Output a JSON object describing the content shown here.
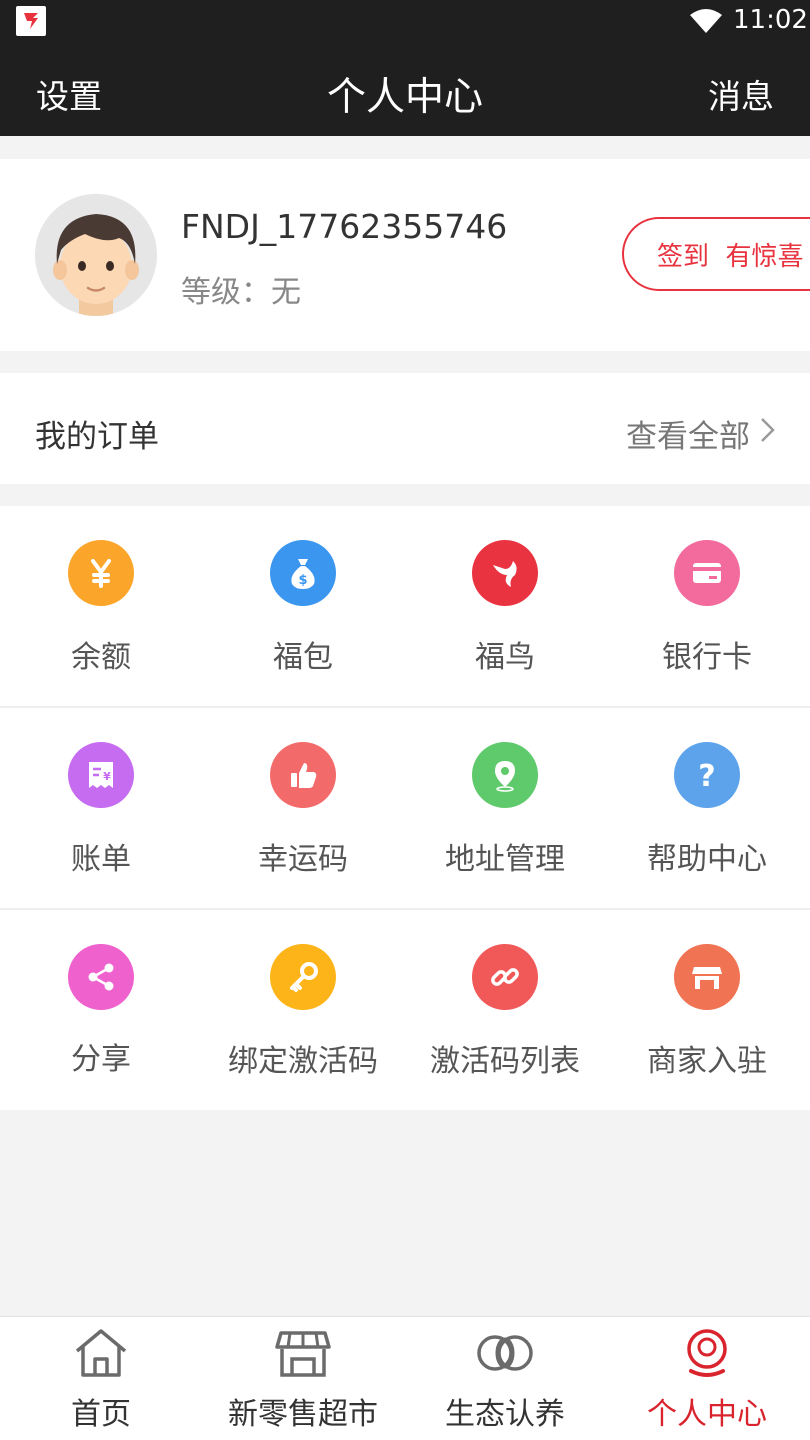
{
  "status_bar": {
    "time": "11:02",
    "app_icon": "fniao-app-icon",
    "signal_icon": "wifi-icon"
  },
  "header": {
    "left": "设置",
    "title": "个人中心",
    "right": "消息"
  },
  "profile": {
    "username": "FNDJ_17762355746",
    "level": "等级：无",
    "checkin_label": "签到  有惊喜",
    "avatar_icon": "avatar-boy-icon"
  },
  "orders": {
    "label": "我的订单",
    "view_all": "查看全部",
    "chevron_icon": "chevron-right-icon"
  },
  "features": [
    {
      "label": "余额",
      "icon": "yuan-coin-icon",
      "color": "#fba52a"
    },
    {
      "label": "福包",
      "icon": "money-bag-icon",
      "color": "#3b96ef"
    },
    {
      "label": "福鸟",
      "icon": "fniao-bird-icon",
      "color": "#ea3341"
    },
    {
      "label": "银行卡",
      "icon": "bank-card-icon",
      "color": "#f36a9c"
    },
    {
      "label": "账单",
      "icon": "bill-icon",
      "color": "#c66cf0"
    },
    {
      "label": "幸运码",
      "icon": "thumbs-up-icon",
      "color": "#f36a6a"
    },
    {
      "label": "地址管理",
      "icon": "location-pin-icon",
      "color": "#5fca6b"
    },
    {
      "label": "帮助中心",
      "icon": "question-icon",
      "color": "#5ca3ec"
    },
    {
      "label": "分享",
      "icon": "share-icon",
      "color": "#ef62ce"
    },
    {
      "label": "绑定激活码",
      "icon": "key-icon",
      "color": "#fdb418"
    },
    {
      "label": "激活码列表",
      "icon": "link-icon",
      "color": "#f15858"
    },
    {
      "label": "商家入驻",
      "icon": "storefront-icon",
      "color": "#f07353"
    }
  ],
  "tabbar": {
    "active_color": "#d9242e",
    "items": [
      {
        "label": "首页",
        "icon": "home-icon"
      },
      {
        "label": "新零售超市",
        "icon": "store-icon"
      },
      {
        "label": "生态认养",
        "icon": "rings-icon"
      },
      {
        "label": "个人中心",
        "icon": "person-icon"
      }
    ],
    "active_index": 3
  }
}
